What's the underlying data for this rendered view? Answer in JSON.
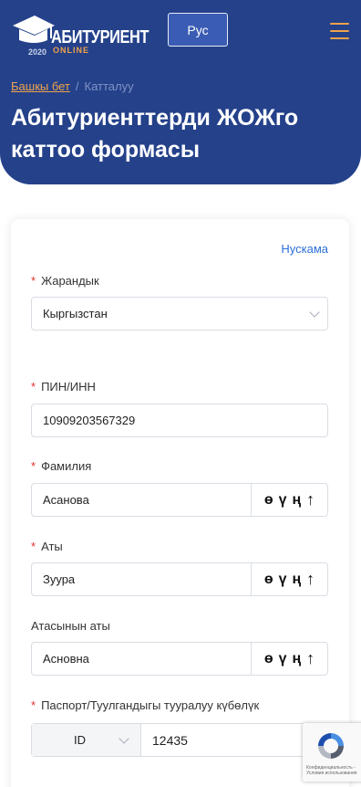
{
  "header": {
    "logo": {
      "name": "АБИТУРИЕНТ",
      "sub": "ONLINE",
      "year": "2020"
    },
    "language_label": "Рус",
    "breadcrumb": {
      "home": "Башкы бет",
      "separator": "/",
      "current": "Катталуу"
    },
    "title": "Абитуриенттерди ЖОЖго каттоо формасы"
  },
  "form": {
    "sample_link": "Нускама",
    "required_mark": "*",
    "citizenship": {
      "label": "Жарандык",
      "value": "Кыргызстан"
    },
    "pin": {
      "label": "ПИН/ИНН",
      "value": "10909203567329"
    },
    "surname": {
      "label": "Фамилия",
      "value": "Асанова"
    },
    "first_name": {
      "label": "Аты",
      "value": "Зуура"
    },
    "patronymic": {
      "label": "Атасынын аты",
      "value": "Асновна"
    },
    "kyrgyz_letters": [
      "ө",
      "ү",
      "ң"
    ],
    "upper_arrow": "↑",
    "document": {
      "label": "Паспорт/Туулгандыгы тууралуу күбөлүк",
      "type": "ID",
      "number": "12435"
    }
  },
  "recaptcha": {
    "text_line1": "Конфиденциальность -",
    "text_line2": "Условия использования"
  },
  "colors": {
    "header_bg": "#24418a",
    "accent_orange": "#f0a24a",
    "required_red": "#e0322c",
    "link_blue": "#2c6fd6"
  }
}
